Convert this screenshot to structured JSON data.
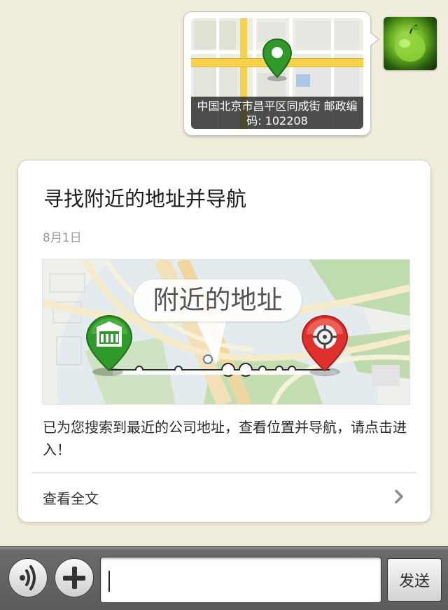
{
  "location_message": {
    "address": "中国北京市昌平区同成街 邮政编码: 102208",
    "map_pin_icon": "location-pin-icon"
  },
  "avatar": {
    "icon": "green-apple-avatar"
  },
  "article": {
    "title": "寻找附近的地址并导航",
    "date": "8月1日",
    "banner_label": "附近的地址",
    "description": "已为您搜索到最近的公司地址，查看位置并导航，请点击进入！",
    "read_full_label": "查看全文",
    "read_full_icon": "chevron-right-icon",
    "start_icon": "building-pin-icon",
    "end_icon": "target-pin-icon"
  },
  "input_bar": {
    "voice_icon": "voice-icon",
    "add_icon": "plus-icon",
    "message_value": "",
    "send_label": "发送"
  },
  "colors": {
    "background": "#f0eddc",
    "start_pin": "#2f9a2a",
    "end_pin": "#e0302e",
    "road_yellow": "#f5d247"
  }
}
